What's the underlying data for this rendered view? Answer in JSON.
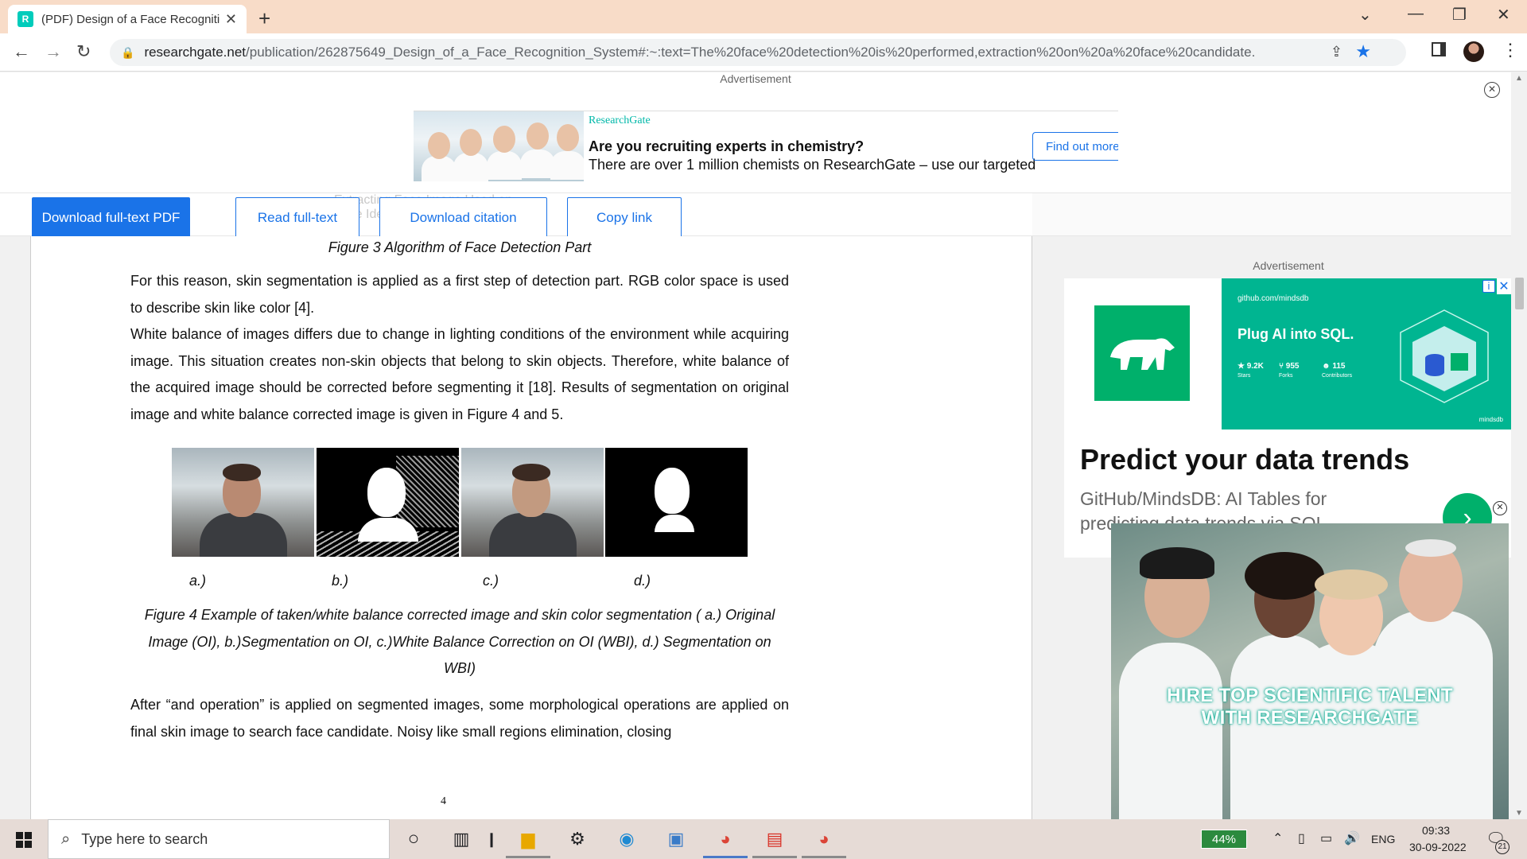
{
  "browser": {
    "tab_title": "(PDF) Design of a Face Recognition",
    "tab_favicon": "R",
    "url_domain": "researchgate.net",
    "url_path": "/publication/262875649_Design_of_a_Face_Recognition_System#:~:text=The%20face%20detection%20is%20performed,extraction%20on%20a%20face%20candidate."
  },
  "top_ad": {
    "label": "Advertisement",
    "brand": "ResearchGate",
    "headline": "Are you recruiting experts in chemistry?",
    "body": "There are over 1 million chemists on ResearchGate – use our targeted",
    "cta": "Find out more"
  },
  "actions": {
    "download_pdf": "Download full-text PDF",
    "read_full_text": "Read full-text",
    "download_citation": "Download citation",
    "copy_link": "Copy link",
    "ghost_text": "Extracting Face Image Used on Face Identification"
  },
  "document": {
    "figure3_caption": "Figure 3 Algorithm of Face Detection Part",
    "paragraph1": "For this reason, skin segmentation is applied as a first step of detection part. RGB color space is used to describe skin like color [4].",
    "paragraph2": "White balance of images differs due to change in lighting conditions of the environment while acquiring image. This situation creates non-skin objects that belong to skin objects. Therefore, white balance of the acquired image should be corrected before segmenting it [18]. Results of segmentation on original image and white balance corrected image is given in Figure 4 and 5.",
    "subfig_labels": [
      "a.)",
      "b.)",
      "c.)",
      "d.)"
    ],
    "figure4_caption": "Figure 4 Example of taken/white balance corrected image and skin color segmentation ( a.) Original Image (OI), b.)Segmentation on OI, c.)White Balance Correction on OI (WBI), d.) Segmentation on WBI)",
    "paragraph3": "After “and operation” is applied on segmented images, some morphological operations are applied on final skin image to search face candidate. Noisy like small regions elimination, closing",
    "page_number": "4"
  },
  "right_ad": {
    "label": "Advertisement",
    "domain": "github.com/mindsdb",
    "banner_headline": "Plug AI into SQL.",
    "stat_stars": "9.2K",
    "stat_stars_label": "Stars",
    "stat_forks": "955",
    "stat_forks_label": "Forks",
    "stat_contrib": "115",
    "stat_contrib_label": "Contributors",
    "banner_brand": "mindsdb",
    "headline": "Predict your data trends",
    "body": "GitHub/MindsDB: AI Tables for predicting data trends via SQL"
  },
  "video_ad": {
    "caption_line1": "HIRE TOP SCIENTIFIC TALENT",
    "caption_line2": "WITH RESEARCHGATE"
  },
  "taskbar": {
    "search_placeholder": "Type here to search",
    "battery": "44%",
    "language": "ENG",
    "time": "09:33",
    "date": "30-09-2022",
    "notifications": "21"
  },
  "colors": {
    "tab_bar": "#f8dcc8",
    "accent_blue": "#1a73e8",
    "mindsdb_green": "#00b06b",
    "mindsdb_teal": "#00b591"
  }
}
